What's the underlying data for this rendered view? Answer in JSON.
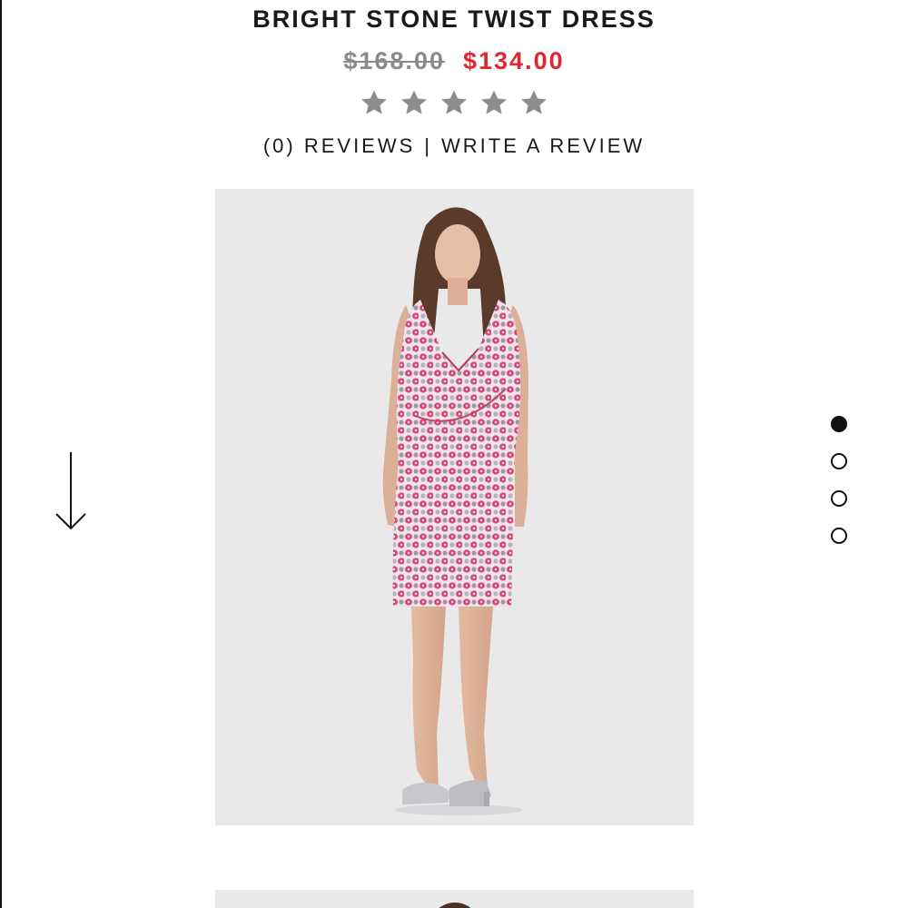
{
  "product": {
    "title": "BRIGHT STONE TWIST DRESS",
    "price_original": "$168.00",
    "price_sale": "$134.00",
    "rating_value": 0,
    "rating_max": 5,
    "reviews_label": "(0) REVIEWS",
    "separator": "|",
    "write_review_label": "WRITE A REVIEW"
  },
  "gallery": {
    "slide_count": 4,
    "active_slide": 1,
    "main_image": "model-in-pink-patterned-dress",
    "next_image": "model-second-view"
  },
  "icons": {
    "star": "star-icon",
    "scroll": "down-arrow-icon"
  },
  "colors": {
    "sale": "#e0262e",
    "original_price": "#8a8a8a",
    "star_empty": "#8c8c8c",
    "photo_bg": "#e9e9ea",
    "dress_pink": "#d8477a"
  }
}
